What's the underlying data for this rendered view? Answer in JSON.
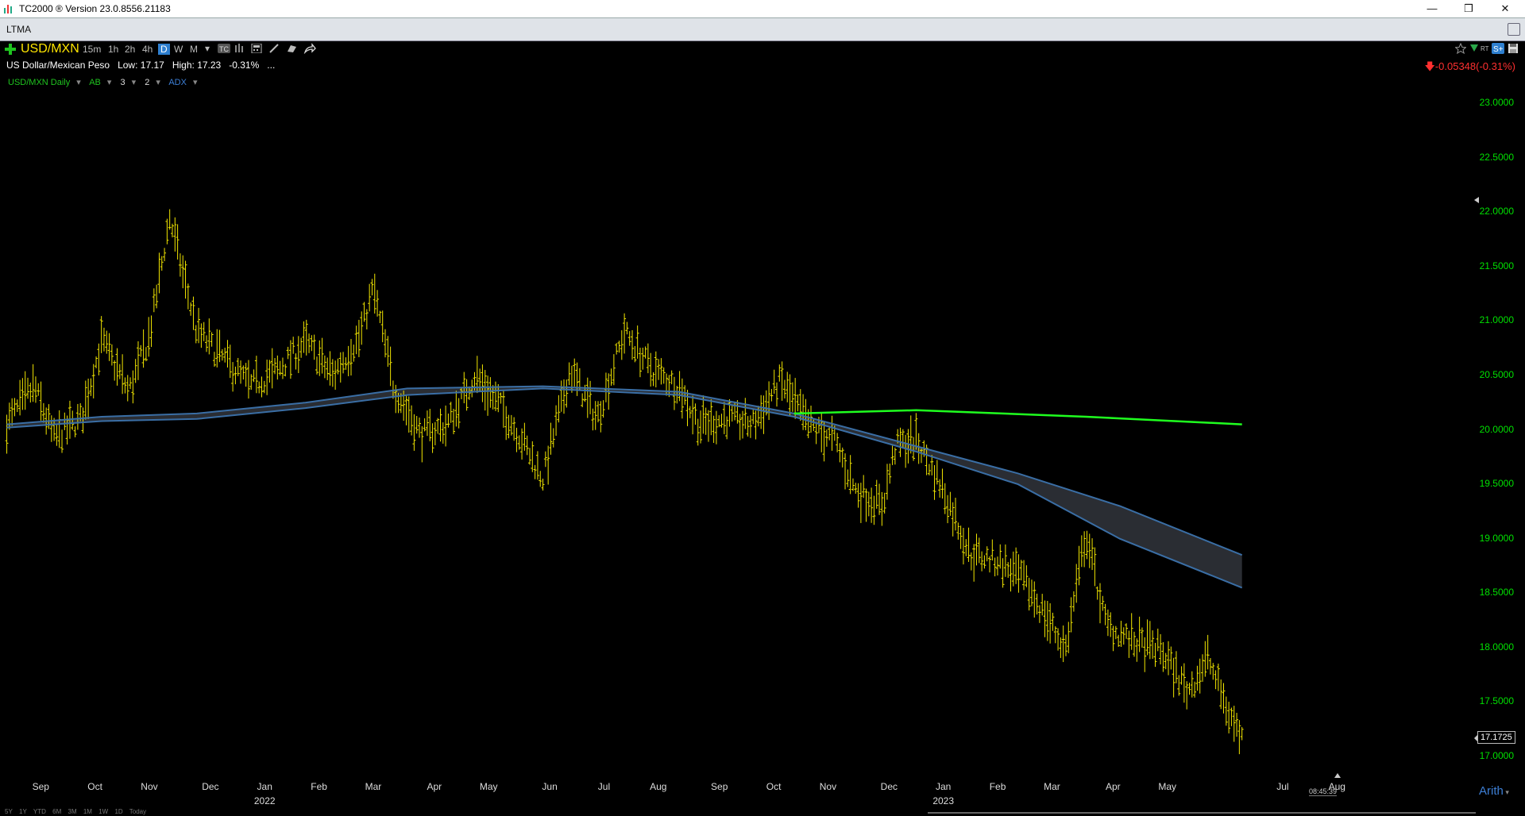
{
  "window": {
    "title": "TC2000 ® Version 23.0.8556.21183",
    "controls": [
      "—",
      "❒",
      "✕"
    ]
  },
  "tabs": [
    {
      "label": "LTMA"
    }
  ],
  "toolbar": {
    "add_icon": "plus-icon",
    "symbol": "USD/MXN",
    "timeframes": [
      "15m",
      "1h",
      "2h",
      "4h",
      "D",
      "W",
      "M"
    ],
    "active_timeframe": "D",
    "icons": [
      "dropdown-icon",
      "tc-icon",
      "bars-icon",
      "calculator-icon",
      "pencil-icon",
      "note-icon",
      "share-icon"
    ],
    "right_icons": [
      "star-icon",
      "alert-icon",
      "rt-icon",
      "s-plus-icon",
      "save-icon"
    ],
    "rt_label": "RT"
  },
  "quote": {
    "name": "US Dollar/Mexican Peso",
    "low_label": "Low:",
    "low": "17.17",
    "high_label": "High:",
    "high": "17.23",
    "pct": "-0.31%",
    "more": "...",
    "change": "-0.05348",
    "change_pct": "(-0.31%)"
  },
  "overlay": {
    "series": "USD/MXN Daily",
    "ab": "AB",
    "n1": "3",
    "n2": "2",
    "adx": "ADX",
    "colors": {
      "series": "#1fc41f",
      "ab": "#1fc41f",
      "adx": "#3d7fd6"
    }
  },
  "chart_data": {
    "type": "bar",
    "series_color": "#f2e600",
    "ylim": [
      17.0,
      23.0
    ],
    "y_ticks": [
      "23.0000",
      "22.5000",
      "22.0000",
      "21.5000",
      "21.0000",
      "20.5000",
      "20.0000",
      "19.5000",
      "19.0000",
      "18.5000",
      "18.0000",
      "17.5000",
      "17.0000"
    ],
    "x_months": [
      "Sep",
      "Oct",
      "Nov",
      "Dec",
      "Jan",
      "Feb",
      "Mar",
      "Apr",
      "May",
      "Jun",
      "Jul",
      "Aug",
      "Sep",
      "Oct",
      "Nov",
      "Dec",
      "Jan",
      "Feb",
      "Mar",
      "Apr",
      "May",
      "Jul",
      "Aug"
    ],
    "x_years": [
      "2022",
      "2023"
    ],
    "last_price": "17.1725",
    "price_path": [
      [
        2021.66,
        20.05
      ],
      [
        2021.7,
        20.4
      ],
      [
        2021.73,
        19.92
      ],
      [
        2021.77,
        20.1
      ],
      [
        2021.8,
        20.82
      ],
      [
        2021.84,
        20.35
      ],
      [
        2021.87,
        20.85
      ],
      [
        2021.9,
        21.95
      ],
      [
        2021.94,
        20.9
      ],
      [
        2021.98,
        20.65
      ],
      [
        2022.02,
        20.4
      ],
      [
        2022.06,
        20.55
      ],
      [
        2022.1,
        20.8
      ],
      [
        2022.14,
        20.5
      ],
      [
        2022.18,
        20.85
      ],
      [
        2022.2,
        21.3
      ],
      [
        2022.23,
        20.4
      ],
      [
        2022.27,
        19.95
      ],
      [
        2022.31,
        20.05
      ],
      [
        2022.35,
        20.5
      ],
      [
        2022.39,
        20.2
      ],
      [
        2022.42,
        19.9
      ],
      [
        2022.45,
        19.55
      ],
      [
        2022.49,
        20.55
      ],
      [
        2022.53,
        20.1
      ],
      [
        2022.57,
        20.9
      ],
      [
        2022.61,
        20.55
      ],
      [
        2022.65,
        20.4
      ],
      [
        2022.68,
        20.05
      ],
      [
        2022.72,
        20.1
      ],
      [
        2022.76,
        20.05
      ],
      [
        2022.8,
        20.45
      ],
      [
        2022.84,
        20.05
      ],
      [
        2022.88,
        19.9
      ],
      [
        2022.91,
        19.45
      ],
      [
        2022.95,
        19.3
      ],
      [
        2022.97,
        19.85
      ],
      [
        2023.0,
        19.9
      ],
      [
        2023.04,
        19.45
      ],
      [
        2023.08,
        18.85
      ],
      [
        2023.12,
        18.8
      ],
      [
        2023.16,
        18.6
      ],
      [
        2023.19,
        18.3
      ],
      [
        2023.22,
        17.98
      ],
      [
        2023.25,
        19.05
      ],
      [
        2023.28,
        18.2
      ],
      [
        2023.32,
        18.05
      ],
      [
        2023.36,
        17.98
      ],
      [
        2023.4,
        17.6
      ],
      [
        2023.43,
        17.9
      ],
      [
        2023.46,
        17.4
      ],
      [
        2023.48,
        17.17
      ]
    ],
    "ma_green": {
      "color": "#1fff1f",
      "points": [
        [
          2022.82,
          20.15
        ],
        [
          2023.0,
          20.18
        ],
        [
          2023.25,
          20.12
        ],
        [
          2023.48,
          20.05
        ]
      ]
    },
    "band_upper": {
      "color": "#3a6ea5",
      "points": [
        [
          2021.66,
          20.05
        ],
        [
          2021.8,
          20.12
        ],
        [
          2021.94,
          20.15
        ],
        [
          2022.1,
          20.25
        ],
        [
          2022.25,
          20.38
        ],
        [
          2022.45,
          20.4
        ],
        [
          2022.65,
          20.35
        ],
        [
          2022.82,
          20.15
        ],
        [
          2023.0,
          19.85
        ],
        [
          2023.15,
          19.6
        ],
        [
          2023.3,
          19.3
        ],
        [
          2023.48,
          18.85
        ]
      ]
    },
    "band_lower": {
      "color": "#3a6ea5",
      "points": [
        [
          2021.66,
          20.02
        ],
        [
          2021.8,
          20.08
        ],
        [
          2021.94,
          20.1
        ],
        [
          2022.1,
          20.2
        ],
        [
          2022.25,
          20.32
        ],
        [
          2022.45,
          20.38
        ],
        [
          2022.65,
          20.32
        ],
        [
          2022.82,
          20.12
        ],
        [
          2023.0,
          19.8
        ],
        [
          2023.15,
          19.5
        ],
        [
          2023.3,
          19.0
        ],
        [
          2023.48,
          18.55
        ]
      ]
    }
  },
  "statusbar": {
    "clock": "08:45:39",
    "scale": "Arith",
    "ranges": [
      "5Y",
      "1Y",
      "YTD",
      "6M",
      "3M",
      "1M",
      "1W",
      "1D",
      "Today"
    ]
  }
}
